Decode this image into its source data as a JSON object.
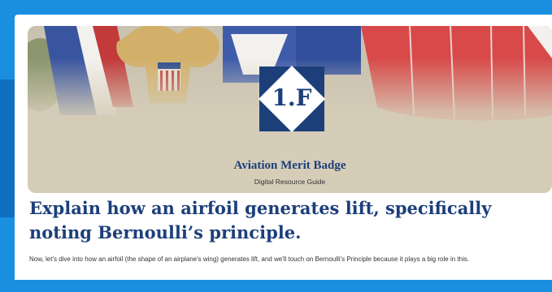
{
  "banner": {
    "badge_number": "1.F",
    "title": "Aviation Merit Badge",
    "subtitle": "Digital Resource Guide"
  },
  "content": {
    "heading": "Explain how an airfoil generates lift, specifically noting Bernoulli’s principle.",
    "paragraph": "Now, let's dive into how an airfoil (the shape of an airplane's wing) generates lift, and we'll touch on Bernoulli's Principle because it plays a big role in this."
  },
  "colors": {
    "frame": "#1a8fe0",
    "accent": "#1c3f7a",
    "banner_bg": "#d6cdb8"
  }
}
